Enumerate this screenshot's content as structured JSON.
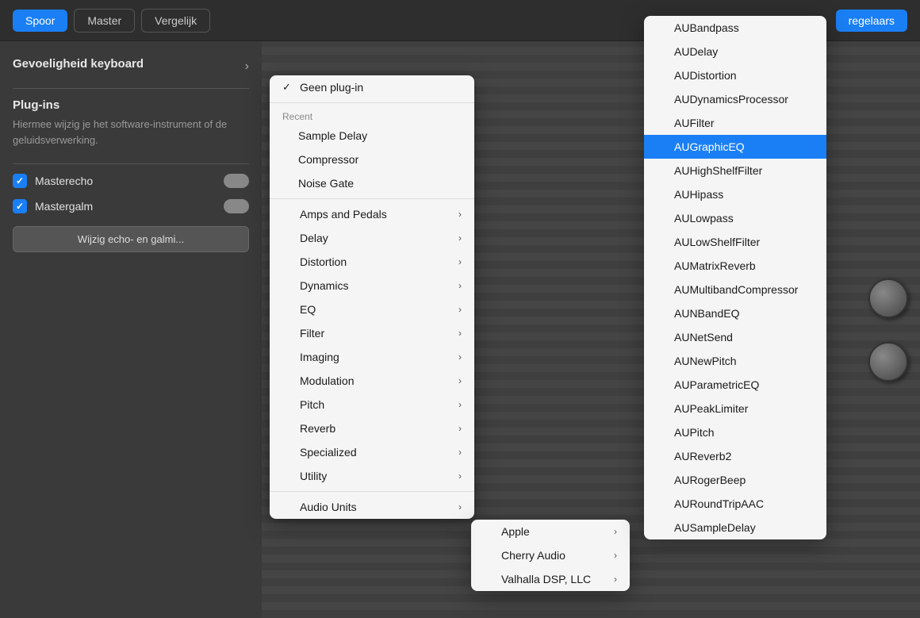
{
  "toolbar": {
    "spoor_label": "Spoor",
    "master_label": "Master",
    "vergelijk_label": "Vergelijk",
    "regelaars_label": "regelaars"
  },
  "left_panel": {
    "keyboard_sensitivity_label": "Gevoeligheid keyboard",
    "plugins_section_label": "Plug-ins",
    "plugins_description": "Hiermee wijzig je het software-instrument of de geluidsverwerking.",
    "masterecho_label": "Masterecho",
    "mastergalm_label": "Mastergalm",
    "action_btn_label": "Wijzig echo- en galmi..."
  },
  "menu1": {
    "no_plugin_label": "Geen plug-in",
    "recent_section": "Recent",
    "recent_items": [
      "Sample Delay",
      "Compressor",
      "Noise Gate"
    ],
    "categories": [
      "Amps and Pedals",
      "Delay",
      "Distortion",
      "Dynamics",
      "EQ",
      "Filter",
      "Imaging",
      "Modulation",
      "Pitch",
      "Reverb",
      "Specialized",
      "Utility",
      "Audio Units"
    ]
  },
  "menu2": {
    "vendors": [
      "Apple",
      "Cherry Audio",
      "Valhalla DSP, LLC"
    ]
  },
  "menu3": {
    "items": [
      "AUBandpass",
      "AUDelay",
      "AUDistortion",
      "AUDynamicsProcessor",
      "AUFilter",
      "AUGraphicEQ",
      "AUHighShelfFilter",
      "AUHipass",
      "AULowpass",
      "AULowShelfFilter",
      "AUMatrixReverb",
      "AUMultibandCompressor",
      "AUNBandEQ",
      "AUNetSend",
      "AUNewPitch",
      "AUParametricEQ",
      "AUPeakLimiter",
      "AUPitch",
      "AUReverb2",
      "AURogerBeep",
      "AURoundTripAAC",
      "AUSampleDelay"
    ],
    "highlighted_index": 5
  }
}
